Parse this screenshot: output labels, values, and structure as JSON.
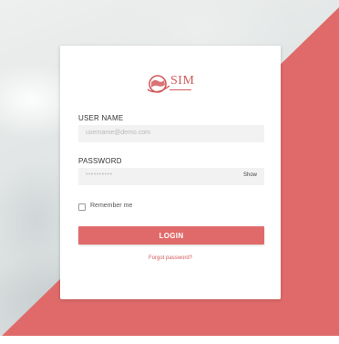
{
  "colors": {
    "accent": "#e06a6a",
    "link": "#d35a5a",
    "field_bg": "#f2f2f2"
  },
  "logo": {
    "text": "SIM",
    "icon": "globe-logo-icon"
  },
  "form": {
    "username_label": "USER NAME",
    "username_placeholder": "username@demo.com",
    "password_label": "PASSWORD",
    "password_value": "••••••••••",
    "show_label": "Show",
    "remember_label": "Remember me",
    "remember_checked": false,
    "login_label": "LOGIN",
    "forgot_label": "Forgot password?"
  }
}
